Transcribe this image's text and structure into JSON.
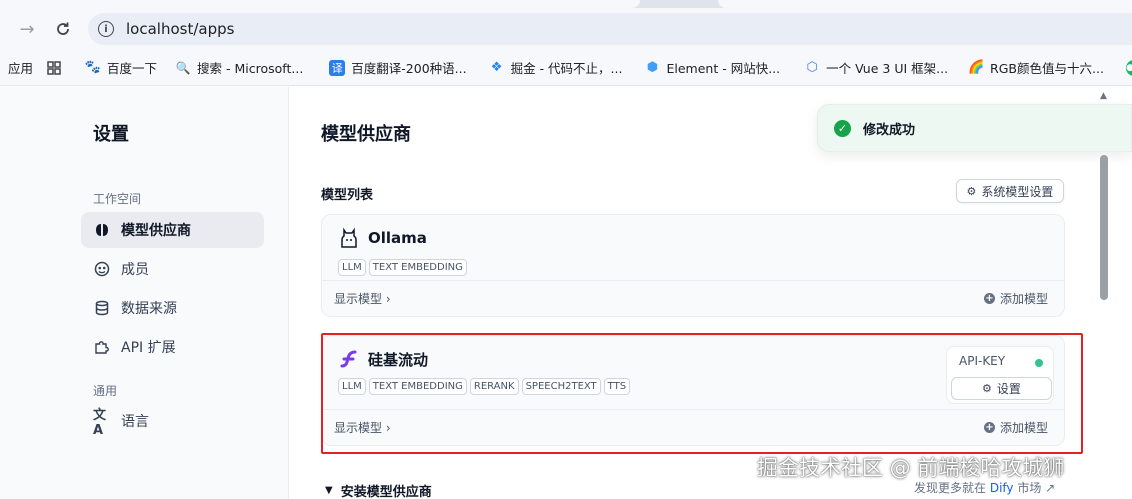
{
  "browser": {
    "url": "localhost/apps",
    "bookmarks": [
      {
        "label": "应用",
        "icon": "apps-grid-icon"
      },
      {
        "label": "百度一下",
        "icon": "baidu-icon"
      },
      {
        "label": "搜索 - Microsoft...",
        "icon": "search-icon"
      },
      {
        "label": "百度翻译-200种语...",
        "icon": "translate-icon"
      },
      {
        "label": "掘金 - 代码不止，...",
        "icon": "juejin-icon"
      },
      {
        "label": "Element - 网站快...",
        "icon": "element-icon"
      },
      {
        "label": "一个 Vue 3 UI 框架...",
        "icon": "vue-icon"
      },
      {
        "label": "RGB颜色值与十六...",
        "icon": "rainbow-icon"
      }
    ]
  },
  "sidebar": {
    "title": "设置",
    "workspace_label": "工作空间",
    "general_label": "通用",
    "items": [
      {
        "label": "模型供应商",
        "icon": "brain-icon",
        "active": true
      },
      {
        "label": "成员",
        "icon": "members-icon",
        "active": false
      },
      {
        "label": "数据来源",
        "icon": "database-icon",
        "active": false
      },
      {
        "label": "API 扩展",
        "icon": "puzzle-icon",
        "active": false
      }
    ],
    "general_items": [
      {
        "label": "语言",
        "icon": "language-icon"
      }
    ]
  },
  "main": {
    "title": "模型供应商",
    "model_list_label": "模型列表",
    "system_model_button": "系统模型设置",
    "providers": [
      {
        "name": "Ollama",
        "tags": [
          "LLM",
          "TEXT EMBEDDING"
        ],
        "show_models": "显示模型",
        "add_model": "添加模型"
      },
      {
        "name": "硅基流动",
        "tags": [
          "LLM",
          "TEXT EMBEDDING",
          "RERANK",
          "SPEECH2TEXT",
          "TTS"
        ],
        "show_models": "显示模型",
        "add_model": "添加模型",
        "api_key_label": "API-KEY",
        "settings_button": "设置",
        "status_color": "#31c48d"
      }
    ],
    "install_label": "安装模型供应商"
  },
  "toast": {
    "message": "修改成功"
  },
  "overlay": {
    "watermark": "掘金技术社区 @ 前端梭哈攻城狮",
    "dify_prefix": "发现更多就在 ",
    "dify_link": "Dify",
    "dify_suffix": " 市场 ↗"
  },
  "colors": {
    "accent": "#155eef",
    "success": "#16a34a",
    "highlight": "#e02424"
  }
}
